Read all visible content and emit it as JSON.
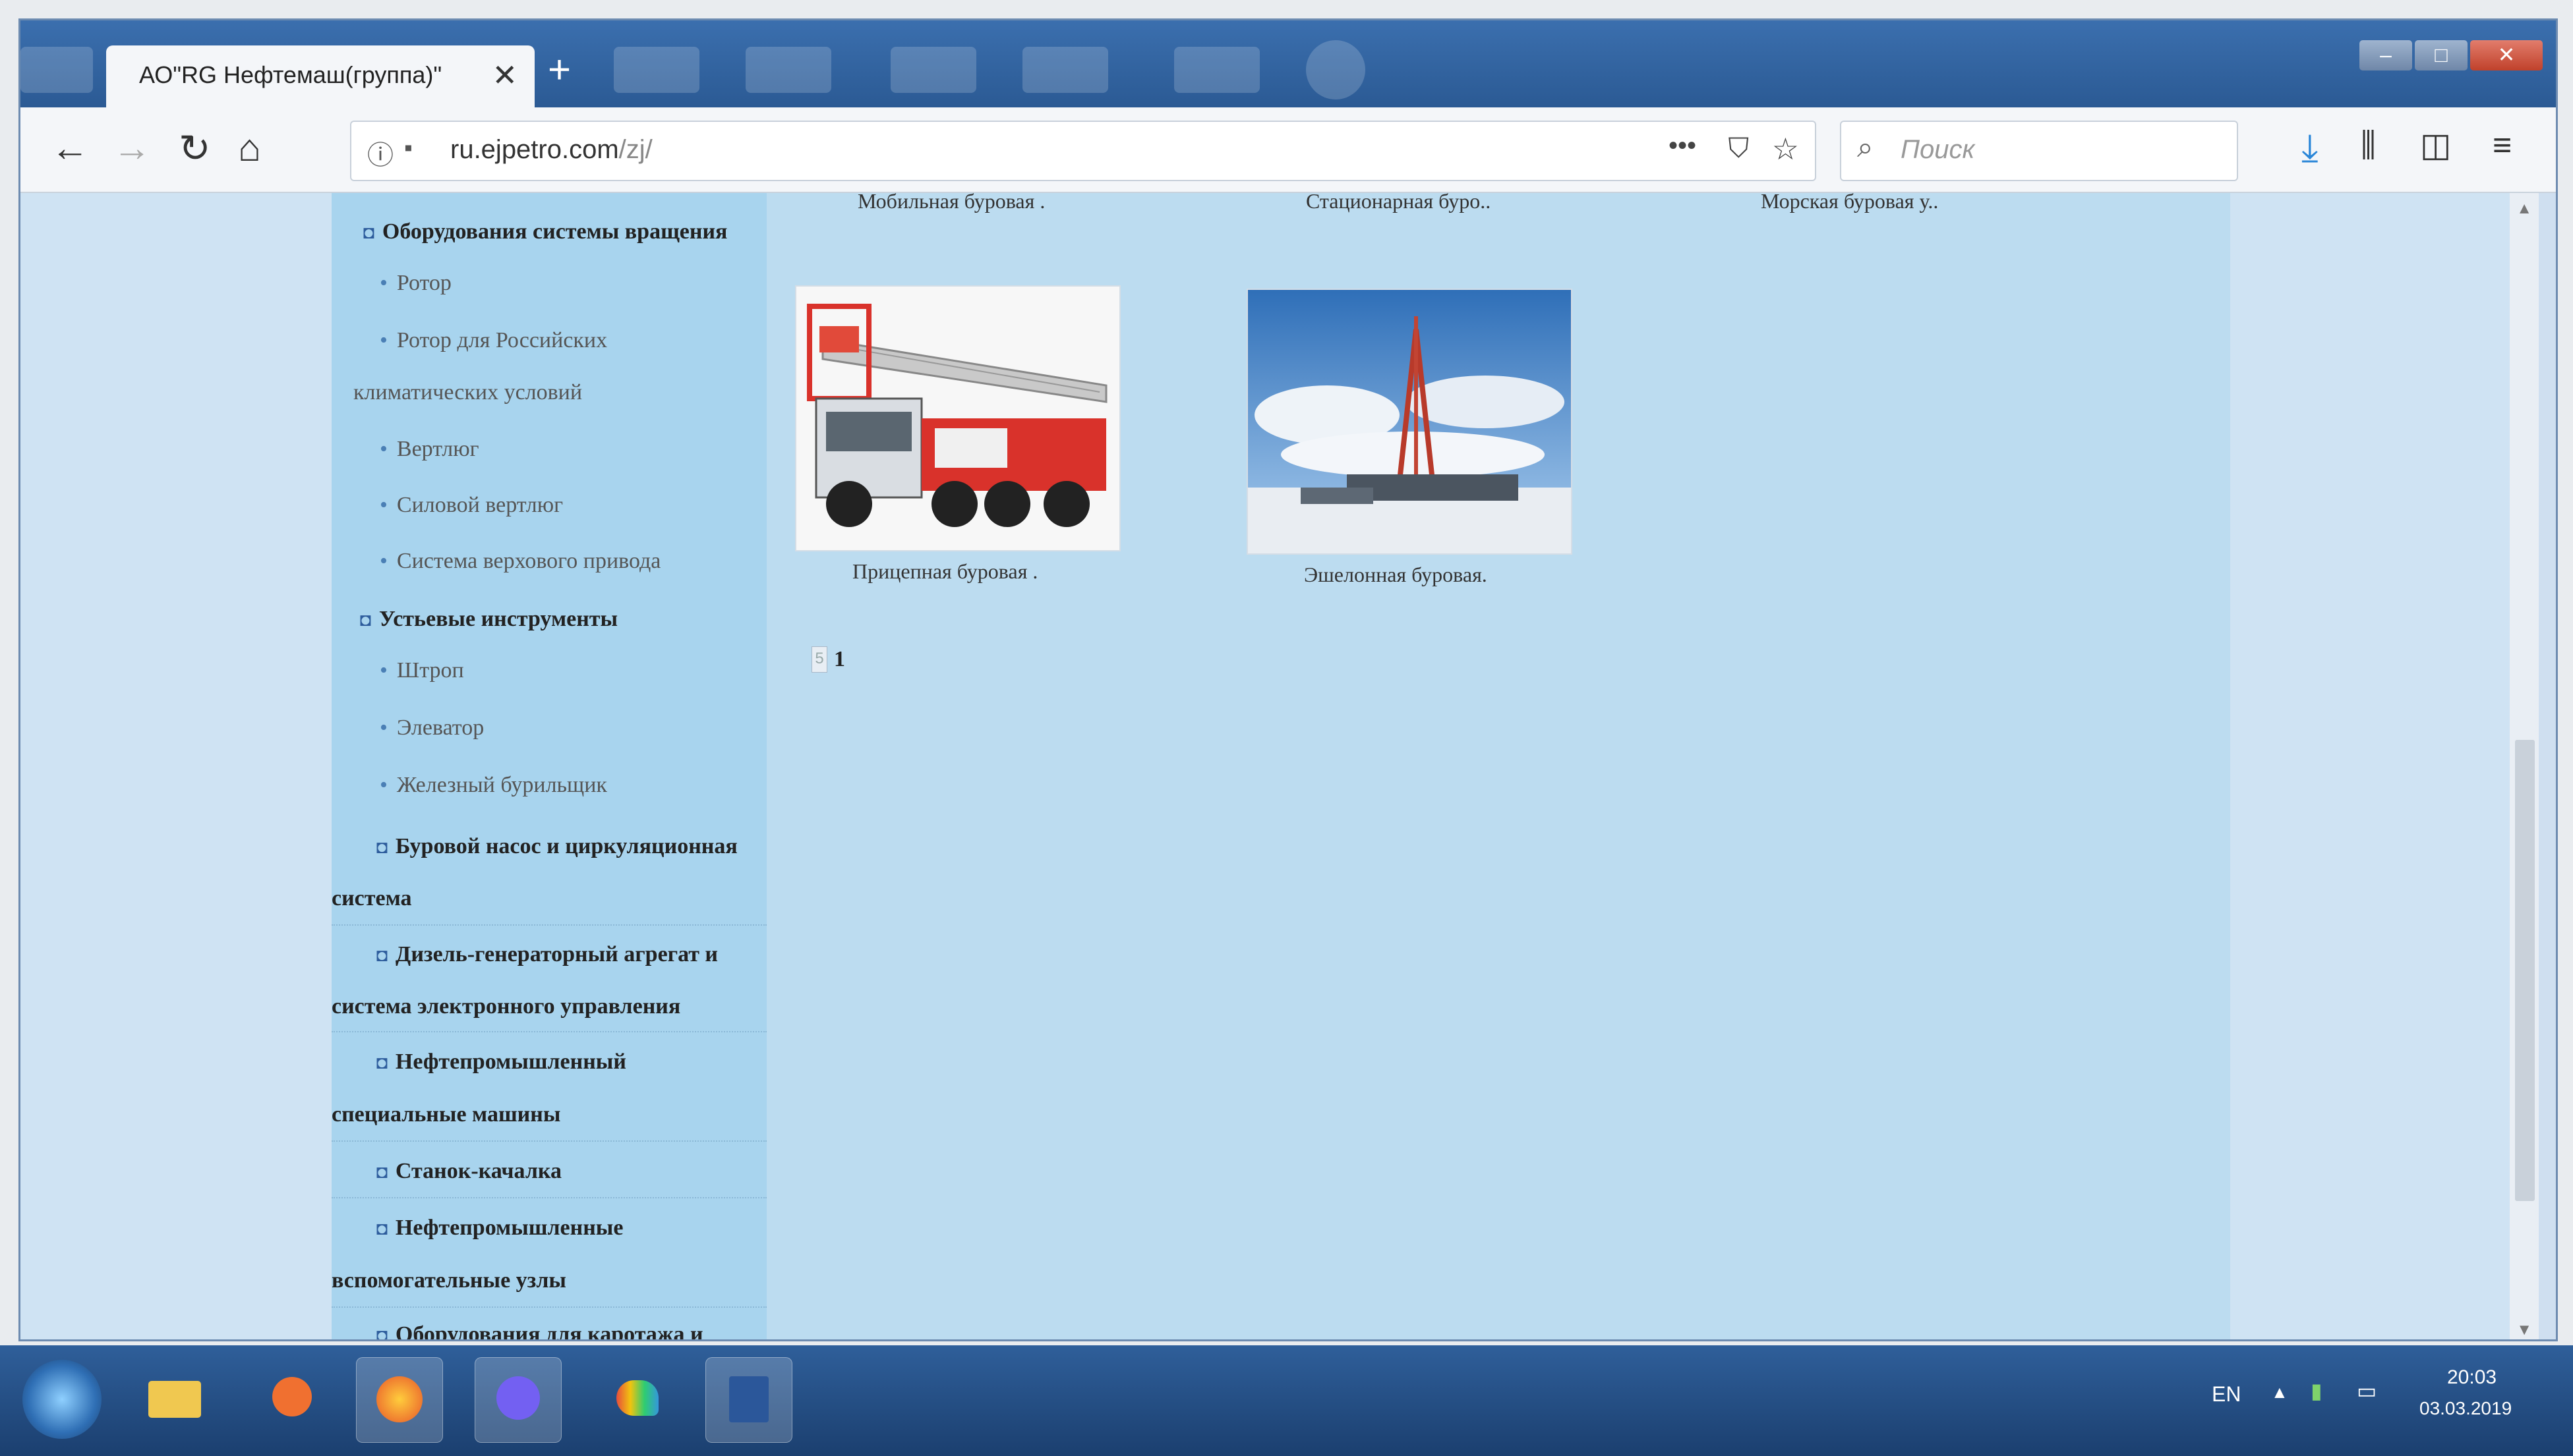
{
  "browser": {
    "tab_title": "АО\"RG Нефтемаш(группа)\"",
    "tab_close": "✕",
    "new_tab": "+",
    "url_host": "ru.ejpetro.com",
    "url_path": "/zj/",
    "search_placeholder": "Поиск",
    "more": "•••"
  },
  "sidebar": {
    "items": [
      {
        "label": "Оборудования системы вращения"
      },
      {
        "label": "Ротор"
      },
      {
        "label": "Ротор для Российских"
      },
      {
        "label": "климатических условий"
      },
      {
        "label": "Вертлюг"
      },
      {
        "label": "Силовой вертлюг"
      },
      {
        "label": "Система верхового привода"
      },
      {
        "label": "Устьевые инструменты"
      },
      {
        "label": "Штроп"
      },
      {
        "label": "Элеватор"
      },
      {
        "label": "Железный бурильщик"
      },
      {
        "label": "Буровой насос и циркуляционная"
      },
      {
        "label": "система"
      },
      {
        "label": "Дизель-генераторный агрегат и"
      },
      {
        "label": "система электронного управления"
      },
      {
        "label": "Нефтепромышленный"
      },
      {
        "label": "специальные машины"
      },
      {
        "label": "Станок-качалка"
      },
      {
        "label": "Нефтепромышленные"
      },
      {
        "label": "вспомогательные узлы"
      },
      {
        "label": "Оборудования для каротажа и"
      }
    ]
  },
  "products": {
    "top_labels": [
      "Мобильная буровая .",
      "Стационарная буро..",
      "Морская буровая у.."
    ],
    "items": [
      {
        "label": "Прицепная буровая ."
      },
      {
        "label": "Эшелонная буровая."
      }
    ]
  },
  "pager": {
    "prev": "5",
    "current": "1"
  },
  "taskbar": {
    "lang": "EN",
    "time": "20:03",
    "date": "03.03.2019"
  },
  "icons": [
    "back-icon",
    "forward-icon",
    "reload-icon",
    "home-icon",
    "info-icon",
    "pocket-icon",
    "bookmark-star-icon",
    "search-icon",
    "download-icon",
    "library-icon",
    "sidebar-icon",
    "menu-icon"
  ]
}
